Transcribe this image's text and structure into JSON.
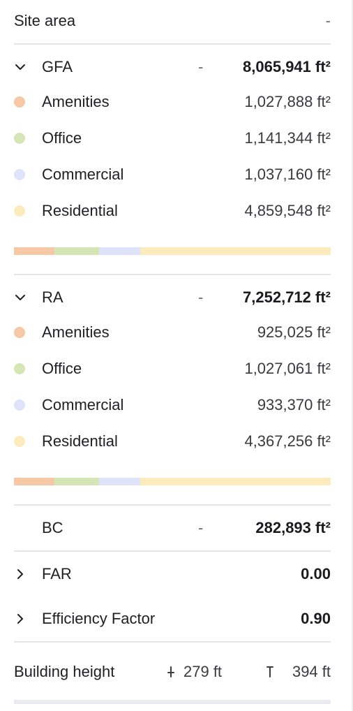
{
  "colors": {
    "amenities": "#f6c8a6",
    "office": "#d6e5b5",
    "commercial": "#dfe3f9",
    "residential": "#fcebbd",
    "divider": "#e6e6ea"
  },
  "site_area": {
    "label": "Site area",
    "value": "-"
  },
  "gfa": {
    "label": "GFA",
    "dash": "-",
    "total": "8,065,941 ft²",
    "expanded": true,
    "items": [
      {
        "label": "Amenities",
        "value": "1,027,888 ft²",
        "color": "#f6c8a6",
        "share": 0.127
      },
      {
        "label": "Office",
        "value": "1,141,344 ft²",
        "color": "#d6e5b5",
        "share": 0.142
      },
      {
        "label": "Commercial",
        "value": "1,037,160 ft²",
        "color": "#dfe3f9",
        "share": 0.129
      },
      {
        "label": "Residential",
        "value": "4,859,548 ft²",
        "color": "#fcebbd",
        "share": 0.602
      }
    ]
  },
  "ra": {
    "label": "RA",
    "dash": "-",
    "total": "7,252,712 ft²",
    "expanded": true,
    "items": [
      {
        "label": "Amenities",
        "value": "925,025 ft²",
        "color": "#f6c8a6",
        "share": 0.128
      },
      {
        "label": "Office",
        "value": "1,027,061 ft²",
        "color": "#d6e5b5",
        "share": 0.142
      },
      {
        "label": "Commercial",
        "value": "933,370 ft²",
        "color": "#dfe3f9",
        "share": 0.129
      },
      {
        "label": "Residential",
        "value": "4,367,256 ft²",
        "color": "#fcebbd",
        "share": 0.602
      }
    ]
  },
  "bc": {
    "label": "BC",
    "dash": "-",
    "value": "282,893 ft²"
  },
  "far": {
    "label": "FAR",
    "value": "0.00",
    "expanded": false
  },
  "efficiency": {
    "label": "Efficiency Factor",
    "value": "0.90",
    "expanded": false
  },
  "building_height": {
    "label": "Building height",
    "min_icon": "min-height-icon",
    "min": "279 ft",
    "max_icon": "max-height-icon",
    "max": "394 ft"
  }
}
